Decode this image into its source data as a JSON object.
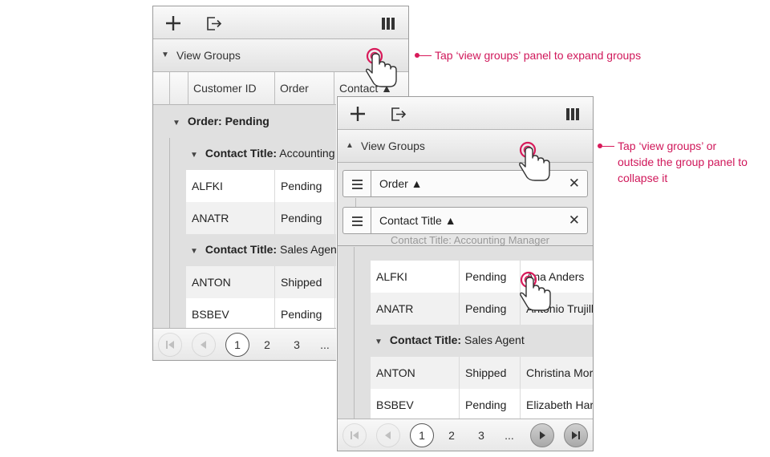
{
  "accent_color": "#d81a5a",
  "grid_a": {
    "view_groups_label": "View Groups",
    "columns": [
      "Customer ID",
      "Order",
      "Contact ▲"
    ],
    "group_order": {
      "prefix": "Order:",
      "value": "Pending"
    },
    "subgroups": [
      {
        "prefix": "Contact Title:",
        "value": "Accounting M"
      },
      {
        "prefix": "Contact Title:",
        "value": "Sales Agent"
      }
    ],
    "rows": [
      {
        "id": "ALFKI",
        "order": "Pending"
      },
      {
        "id": "ANATR",
        "order": "Pending"
      },
      {
        "id": "ANTON",
        "order": "Shipped"
      },
      {
        "id": "BSBEV",
        "order": "Pending"
      }
    ],
    "pages": [
      "1",
      "2",
      "3",
      "..."
    ]
  },
  "grid_b": {
    "view_groups_label": "View Groups",
    "chips": [
      {
        "label": "Order ▲",
        "close": "✕"
      },
      {
        "label": "Contact Title ▲",
        "close": "✕"
      }
    ],
    "partial_group_text": "Contact Title: Accounting Manager",
    "subgroup": {
      "prefix": "Contact Title:",
      "value": "Sales Agent"
    },
    "rows_top": [
      {
        "id": "ALFKI",
        "order": "Pending",
        "contact": "Ana Anders"
      },
      {
        "id": "ANATR",
        "order": "Pending",
        "contact": "Antonio Trujillo"
      }
    ],
    "rows_bottom": [
      {
        "id": "ANTON",
        "order": "Shipped",
        "contact": "Christina More"
      },
      {
        "id": "BSBEV",
        "order": "Pending",
        "contact": "Elizabeth Hard"
      }
    ],
    "pages": [
      "1",
      "2",
      "3",
      "..."
    ]
  },
  "annotations": {
    "expand": "Tap ‘view groups’ panel to expand groups",
    "collapse_line1": "Tap ‘view groups’ or",
    "collapse_line2": "outside the group panel to",
    "collapse_line3": "collapse it"
  },
  "icons": [
    "add-icon",
    "export-icon",
    "columns-icon",
    "first-page-icon",
    "previous-page-icon",
    "next-page-icon",
    "last-page-icon",
    "drag-handle-icon",
    "close-icon",
    "tap-hand-icon"
  ]
}
